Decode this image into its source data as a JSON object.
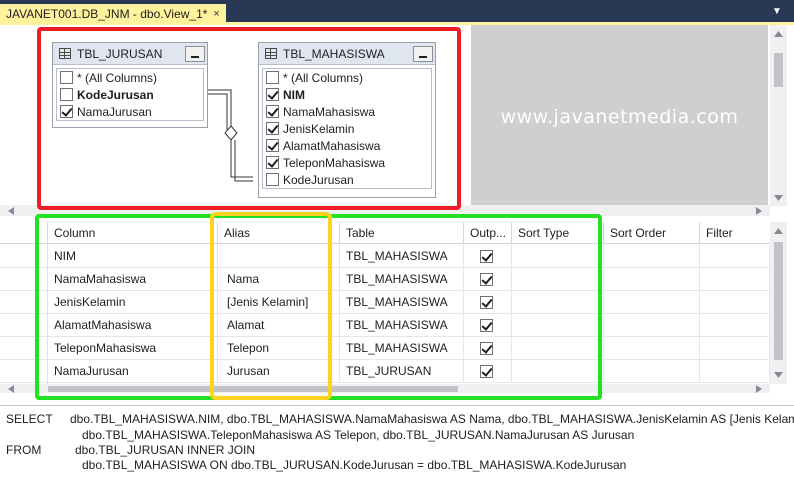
{
  "document_tab": {
    "title": "JAVANET001.DB_JNM - dbo.View_1*",
    "close_glyph": "×"
  },
  "diagram": {
    "watermark": "www.javanetmedia.com",
    "tables": [
      {
        "name": "TBL_JURUSAN",
        "columns": [
          {
            "label": "* (All Columns)",
            "checked": false,
            "bold": false
          },
          {
            "label": "KodeJurusan",
            "checked": false,
            "bold": true
          },
          {
            "label": "NamaJurusan",
            "checked": true,
            "bold": false
          }
        ]
      },
      {
        "name": "TBL_MAHASISWA",
        "columns": [
          {
            "label": "* (All Columns)",
            "checked": false,
            "bold": false
          },
          {
            "label": "NIM",
            "checked": true,
            "bold": true
          },
          {
            "label": "NamaMahasiswa",
            "checked": true,
            "bold": false
          },
          {
            "label": "JenisKelamin",
            "checked": true,
            "bold": false
          },
          {
            "label": "AlamatMahasiswa",
            "checked": true,
            "bold": false
          },
          {
            "label": "TeleponMahasiswa",
            "checked": true,
            "bold": false
          },
          {
            "label": "KodeJurusan",
            "checked": false,
            "bold": false
          }
        ]
      }
    ]
  },
  "grid": {
    "headers": [
      "Column",
      "Alias",
      "Table",
      "Outp...",
      "Sort Type",
      "Sort Order",
      "Filter"
    ],
    "rows": [
      {
        "column": "NIM",
        "alias": "",
        "table": "TBL_MAHASISWA",
        "output": true
      },
      {
        "column": "NamaMahasiswa",
        "alias": "Nama",
        "table": "TBL_MAHASISWA",
        "output": true
      },
      {
        "column": "JenisKelamin",
        "alias": "[Jenis Kelamin]",
        "table": "TBL_MAHASISWA",
        "output": true
      },
      {
        "column": "AlamatMahasiswa",
        "alias": "Alamat",
        "table": "TBL_MAHASISWA",
        "output": true
      },
      {
        "column": "TeleponMahasiswa",
        "alias": "Telepon",
        "table": "TBL_MAHASISWA",
        "output": true
      },
      {
        "column": "NamaJurusan",
        "alias": "Jurusan",
        "table": "TBL_JURUSAN",
        "output": true
      }
    ]
  },
  "sql": {
    "select_kw": "SELECT",
    "select_line1": "dbo.TBL_MAHASISWA.NIM, dbo.TBL_MAHASISWA.NamaMahasiswa AS Nama, dbo.TBL_MAHASISWA.JenisKelamin AS [Jenis Kelamin], d",
    "select_line2": "dbo.TBL_MAHASISWA.TeleponMahasiswa AS Telepon, dbo.TBL_JURUSAN.NamaJurusan AS Jurusan",
    "from_kw": "FROM",
    "from_line1": "dbo.TBL_JURUSAN INNER JOIN",
    "from_line2": "dbo.TBL_MAHASISWA ON dbo.TBL_JURUSAN.KodeJurusan = dbo.TBL_MAHASISWA.KodeJurusan"
  },
  "colors": {
    "highlight_red": "#ee1c24",
    "highlight_green": "#22e022",
    "highlight_yellow": "#ffd21f",
    "tab_active": "#fff29d",
    "tabstrip": "#293955"
  }
}
